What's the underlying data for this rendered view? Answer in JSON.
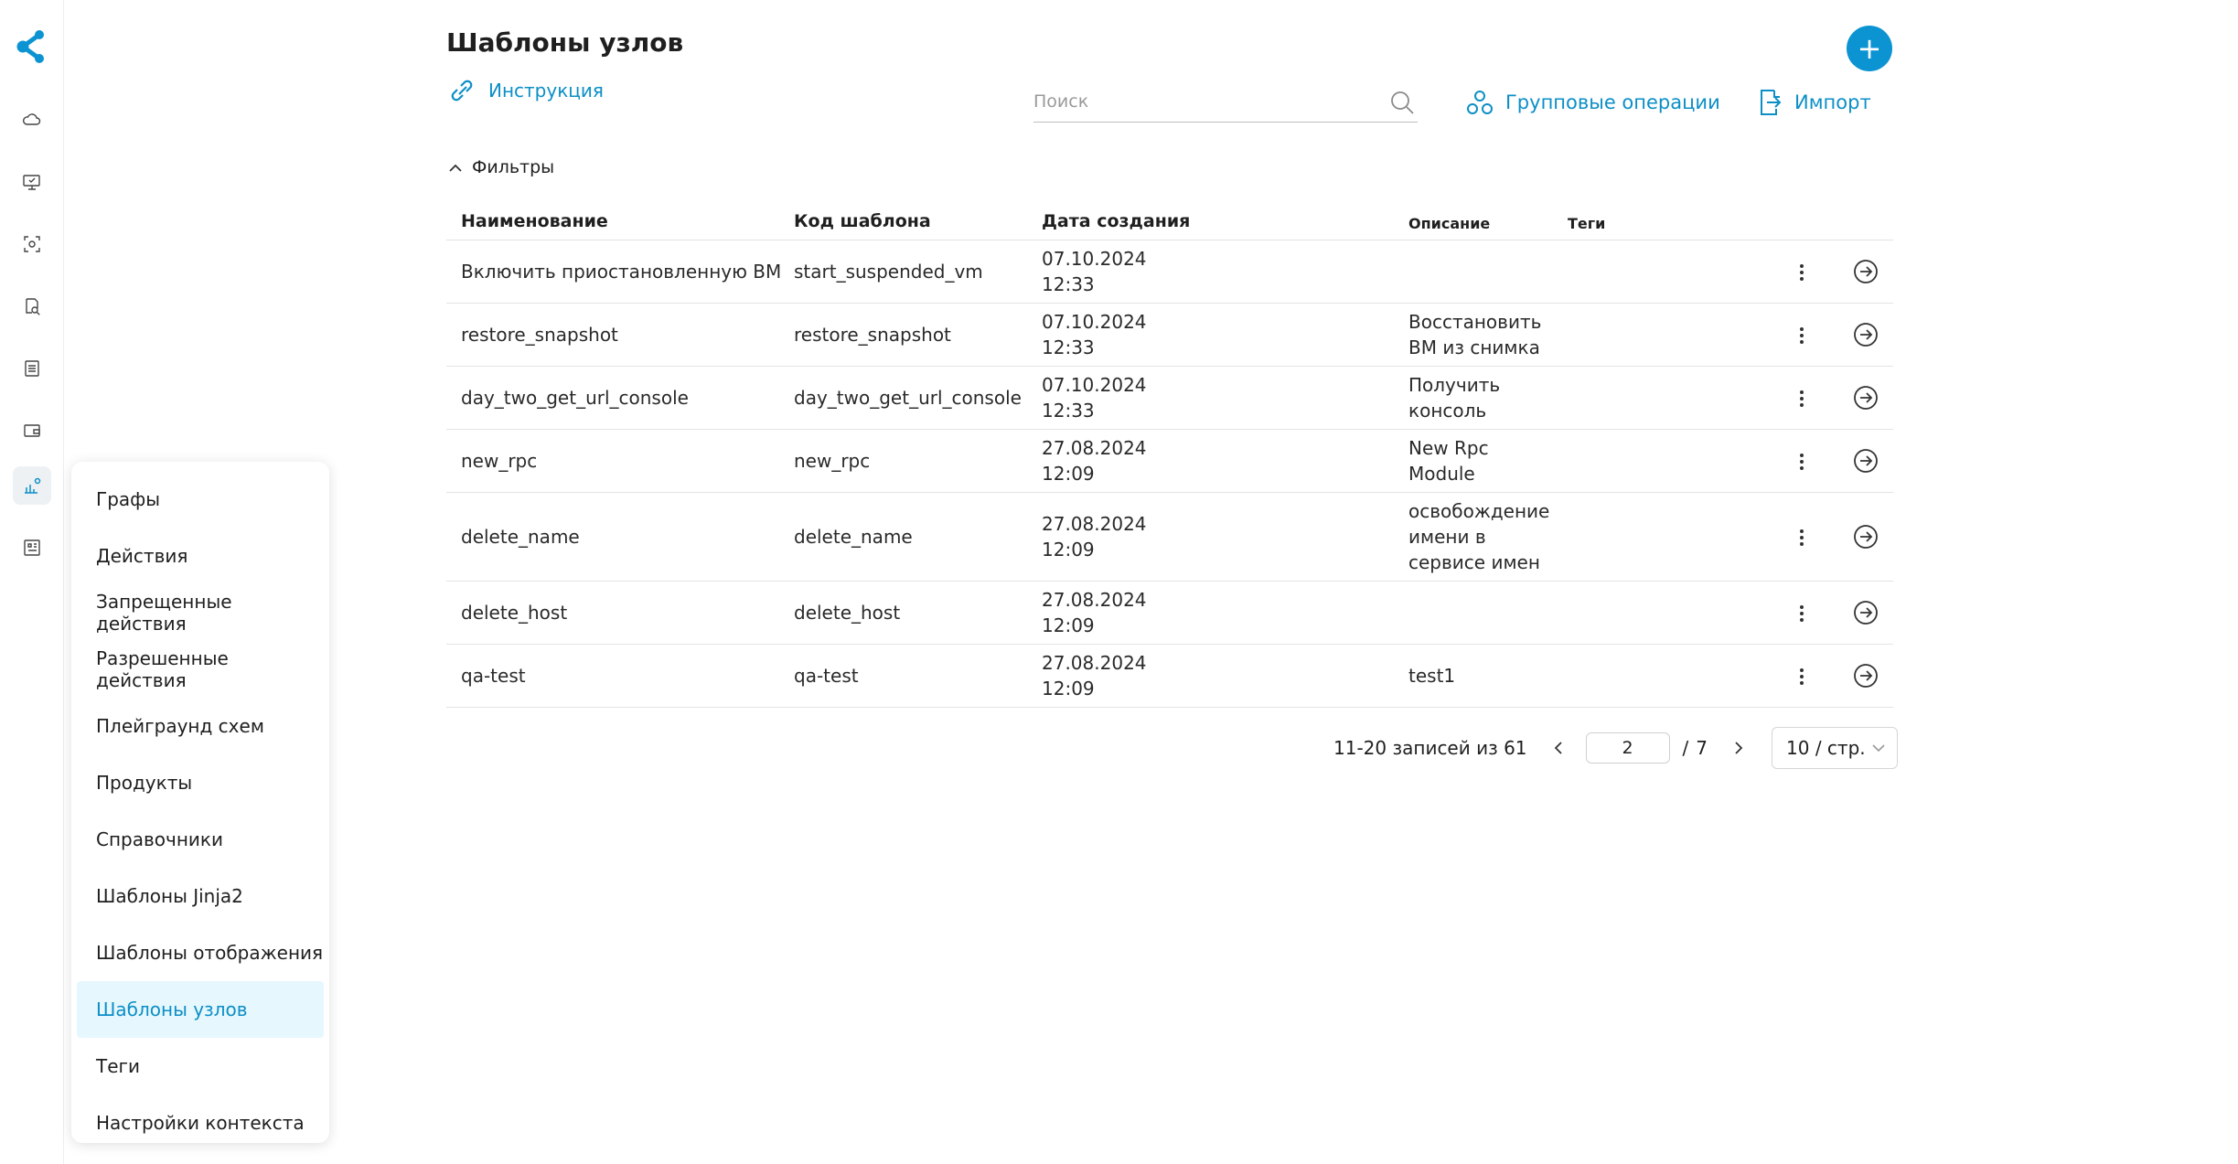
{
  "header": {
    "title": "Шаблоны узлов",
    "instruction_label": "Инструкция",
    "search_placeholder": "Поиск",
    "group_ops_label": "Групповые операции",
    "import_label": "Импорт",
    "add_label": "+"
  },
  "filters": {
    "label": "Фильтры"
  },
  "menu": {
    "items": [
      "Графы",
      "Действия",
      "Запрещенные действия",
      "Разрешенные действия",
      "Плейграунд схем",
      "Продукты",
      "Справочники",
      "Шаблоны Jinja2",
      "Шаблоны отображения",
      "Шаблоны узлов",
      "Теги",
      "Настройки контекста"
    ],
    "active_item": "Шаблоны узлов"
  },
  "table": {
    "columns": [
      "Наименование",
      "Код шаблона",
      "Дата создания",
      "Описание",
      "Теги"
    ],
    "rows": [
      {
        "name": "Включить приостановленную ВМ",
        "code": "start_suspended_vm",
        "date": "07.10.2024",
        "time": "12:33",
        "desc": [
          "",
          ""
        ]
      },
      {
        "name": "restore_snapshot",
        "code": "restore_snapshot",
        "date": "07.10.2024",
        "time": "12:33",
        "desc": [
          "Восстановить",
          "ВМ из снимка"
        ]
      },
      {
        "name": "day_two_get_url_console",
        "code": "day_two_get_url_console",
        "date": "07.10.2024",
        "time": "12:33",
        "desc": [
          "Получить",
          "консоль"
        ]
      },
      {
        "name": "new_rpc",
        "code": "new_rpc",
        "date": "27.08.2024",
        "time": "12:09",
        "desc": [
          "New Rpc",
          "Module"
        ]
      },
      {
        "name": "delete_name",
        "code": "delete_name",
        "date": "27.08.2024",
        "time": "12:09",
        "desc": [
          "освобождение",
          "имени в",
          "сервисе имен"
        ]
      },
      {
        "name": "delete_host",
        "code": "delete_host",
        "date": "27.08.2024",
        "time": "12:09",
        "desc": [
          "",
          ""
        ]
      },
      {
        "name": "qa-test",
        "code": "qa-test",
        "date": "27.08.2024",
        "time": "12:09",
        "desc": [
          "test1"
        ]
      }
    ]
  },
  "pagination": {
    "total_label": "11-20 записей из 61",
    "current_page": "2",
    "total_pages": "7",
    "page_size_label": "10 / стр."
  },
  "colors": {
    "accent": "#0c8fc6",
    "active_menu_bg": "#e6f7fd",
    "add_button": "#0c93d2"
  },
  "icons": {
    "rail": [
      "cloud-icon",
      "monitor-icon",
      "scan-icon",
      "search-doc-icon",
      "list-icon",
      "wallet-icon",
      "chart-settings-icon",
      "dashboard-icon"
    ]
  }
}
